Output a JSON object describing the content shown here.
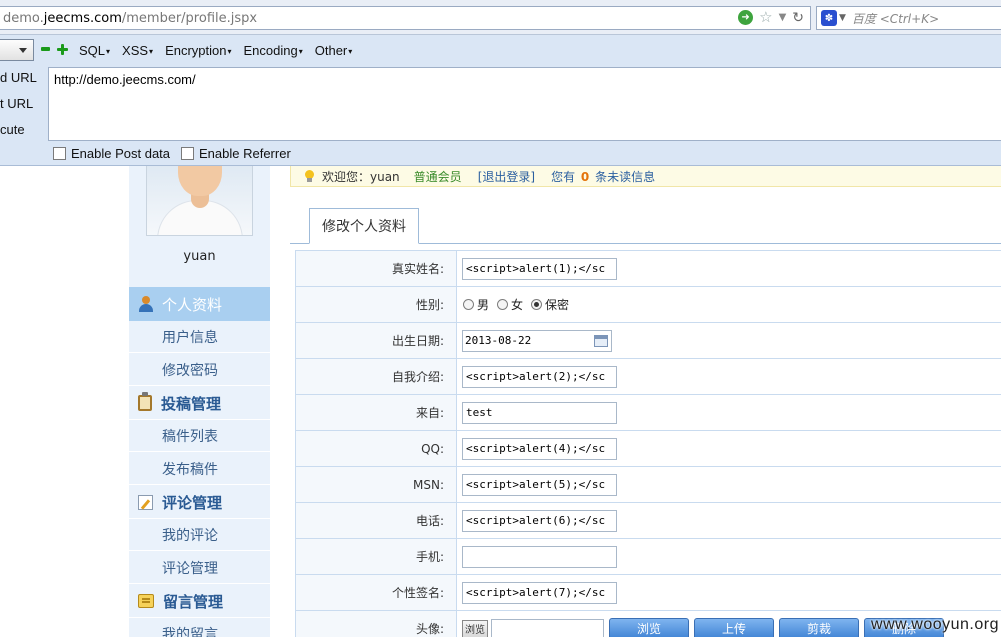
{
  "browser": {
    "url_prefix": "demo.",
    "url_host": "jeecms.com",
    "url_path": "/member/profile.jspx",
    "search_placeholder": "百度 <Ctrl+K>"
  },
  "hackbar": {
    "menus": [
      "SQL",
      "XSS",
      "Encryption",
      "Encoding",
      "Other"
    ],
    "side_labels": [
      "d URL",
      "t URL",
      "cute"
    ],
    "url_text": "http://demo.jeecms.com/",
    "enable_post": "Enable Post data",
    "enable_referrer": "Enable Referrer"
  },
  "sidebar": {
    "username": "yuan",
    "active_item": "个人资料",
    "sections": [
      {
        "title": "个人资料",
        "items": [
          "用户信息",
          "修改密码"
        ]
      },
      {
        "title": "投稿管理",
        "items": [
          "稿件列表",
          "发布稿件"
        ]
      },
      {
        "title": "评论管理",
        "items": [
          "我的评论",
          "评论管理"
        ]
      },
      {
        "title": "留言管理",
        "items": [
          "我的留言"
        ]
      }
    ]
  },
  "notice": {
    "welcome": "欢迎您：yuan",
    "member_type": "普通会员",
    "logout": "[退出登录]",
    "msg_prefix": "您有",
    "msg_count": "0",
    "msg_suffix": "条未读信息"
  },
  "tab": {
    "label": "修改个人资料"
  },
  "form": {
    "rows": [
      {
        "label": "真实姓名:",
        "value": "<script>alert(1);</sc"
      },
      {
        "label": "性别:"
      },
      {
        "label": "出生日期:",
        "value": "2013-08-22"
      },
      {
        "label": "自我介绍:",
        "value": "<script>alert(2);</sc"
      },
      {
        "label": "来自:",
        "value": "test"
      },
      {
        "label": "QQ:",
        "value": "<script>alert(4);</sc"
      },
      {
        "label": "MSN:",
        "value": "<script>alert(5);</sc"
      },
      {
        "label": "电话:",
        "value": "<script>alert(6);</sc"
      },
      {
        "label": "手机:",
        "value": ""
      },
      {
        "label": "个性签名:",
        "value": "<script>alert(7);</sc"
      },
      {
        "label": "头像:"
      }
    ],
    "gender_options": [
      "男",
      "女",
      "保密"
    ],
    "gender_selected": "保密",
    "avatar_buttons": [
      "浏览",
      "上传",
      "剪裁",
      "删除"
    ],
    "browse_small": "浏览"
  },
  "watermark": "www.wooyun.org"
}
